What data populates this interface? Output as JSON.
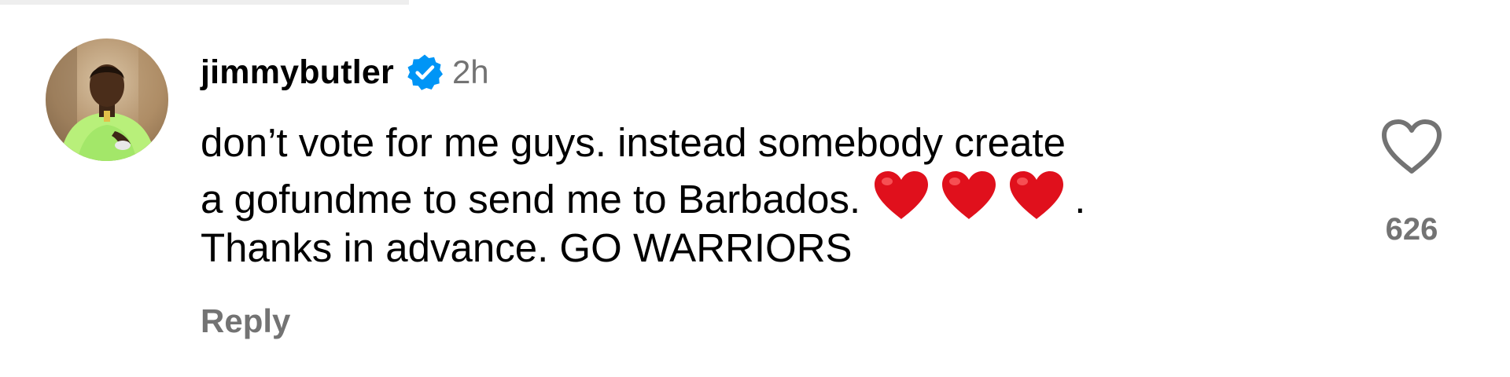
{
  "comment": {
    "author": {
      "username": "jimmybutler",
      "verified": true,
      "avatar_icon": "profile-photo-avatar"
    },
    "timestamp": "2h",
    "text_lines": [
      "don’t vote for me guys. instead somebody create",
      "a gofundme to send me to Barbados.",
      "Thanks in advance. GO WARRIORS"
    ],
    "line2_trailing": ".",
    "emojis": [
      "❤️",
      "❤️",
      "❤️"
    ],
    "reply_label": "Reply",
    "like": {
      "icon": "heart-outline-icon",
      "count": "626"
    }
  },
  "colors": {
    "text_primary": "#000000",
    "text_secondary": "#737373",
    "verified_badge": "#0095f6",
    "heart_emoji": "#e0101c",
    "background": "#ffffff"
  }
}
